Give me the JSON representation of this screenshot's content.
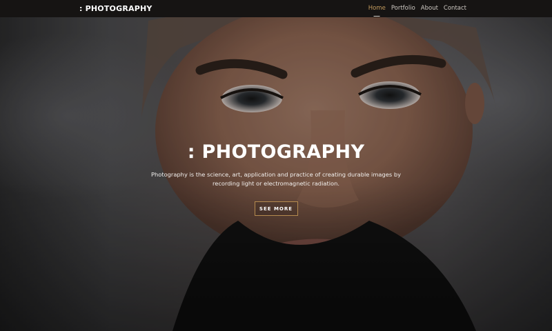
{
  "brand": {
    "name": ": PHOTOGRAPHY"
  },
  "nav": {
    "items": [
      {
        "label": "Home",
        "active": true
      },
      {
        "label": "Portfolio",
        "active": false
      },
      {
        "label": "About",
        "active": false
      },
      {
        "label": "Contact",
        "active": false
      }
    ]
  },
  "hero": {
    "title": ": PHOTOGRAPHY",
    "description": "Photography is the science, art, application and practice of creating durable images by recording light or electromagnetic radiation.",
    "button_label": "SEE MORE"
  },
  "colors": {
    "navbar_bg": "#161413",
    "accent": "#c59d5f",
    "button_border": "#b58b4f",
    "text": "#ffffff"
  }
}
